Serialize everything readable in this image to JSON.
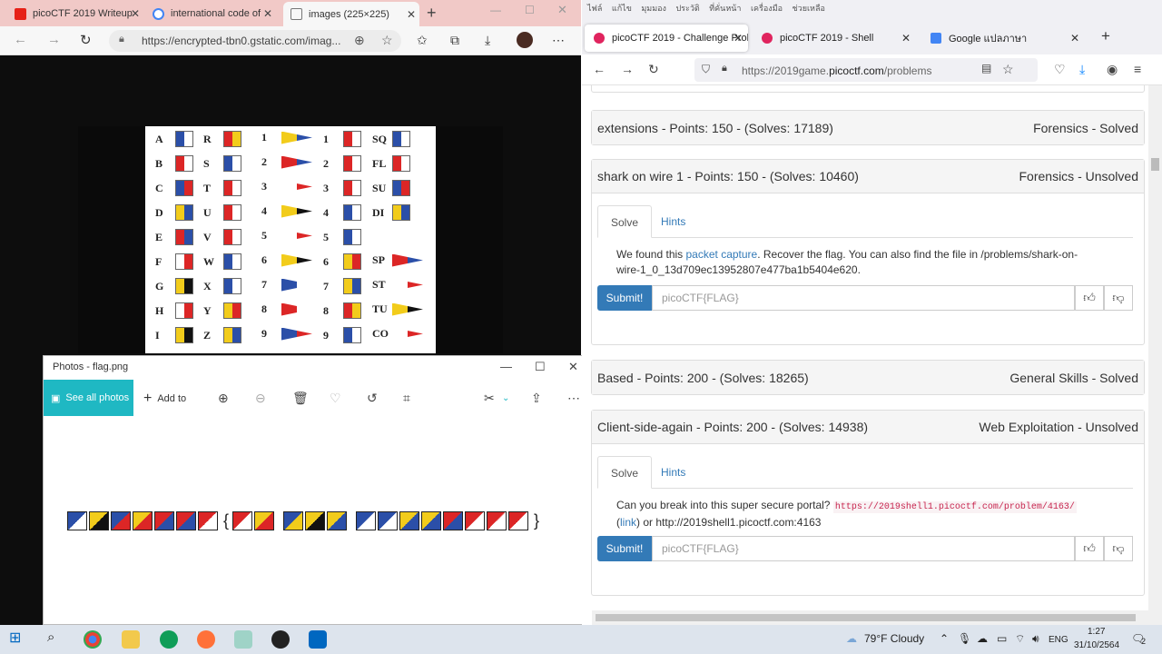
{
  "edge": {
    "tabs": [
      {
        "label": "picoCTF 2019 Writeup",
        "icon": "youtube-icon",
        "color": "#e62117"
      },
      {
        "label": "international code of",
        "icon": "google-icon",
        "color": "#4285f4"
      },
      {
        "label": "images (225×225)",
        "icon": "page-icon",
        "color": "#777"
      }
    ],
    "url": "https://encrypted-tbn0.gstatic.com/imag..."
  },
  "signal_flags": {
    "letters": [
      "A",
      "B",
      "C",
      "D",
      "E",
      "F",
      "G",
      "H",
      "I",
      "R",
      "S",
      "T",
      "U",
      "V",
      "W",
      "X",
      "Y",
      "Z"
    ],
    "numbers": [
      "1",
      "2",
      "3",
      "4",
      "5",
      "6",
      "7",
      "8",
      "9"
    ],
    "subs": [
      "SQ",
      "FL",
      "SU",
      "DI",
      "SP",
      "ST",
      "TU",
      "CO"
    ]
  },
  "photos": {
    "title": "Photos - flag.png",
    "see_all": "See all photos",
    "add_to": "Add to",
    "brace_open": "{",
    "brace_close": "}"
  },
  "firefox": {
    "menu": "ไฟล์ แก้ไข มุมมอง ประวัติ ที่คั่นหน้า เครื่องมือ ช่วยเหลือ",
    "tabs": [
      {
        "label": "picoCTF 2019 - Challenge Probl",
        "color": "#e0245e"
      },
      {
        "label": "picoCTF 2019 - Shell",
        "color": "#e0245e"
      },
      {
        "label": "Google แปลภาษา",
        "color": "#4285f4"
      }
    ],
    "url_prefix": "https://2019game.",
    "url_domain": "picoctf.com",
    "url_suffix": "/problems"
  },
  "problems": [
    {
      "title": "extensions - Points: 150 - (Solves: 17189)",
      "status": "Forensics - Solved"
    },
    {
      "title": "shark on wire 1 - Points: 150 - (Solves: 10460)",
      "status": "Forensics - Unsolved",
      "tab_solve": "Solve",
      "tab_hints": "Hints",
      "desc_pre": "We found this ",
      "desc_link": "packet capture",
      "desc_post": ". Recover the flag. You can also find the file in /problems/shark-on-wire-1_0_13d709ec13952807e477ba1b5404e620.",
      "submit": "Submit!",
      "placeholder": "picoCTF{FLAG}"
    },
    {
      "title": "Based - Points: 200 - (Solves: 18265)",
      "status": "General Skills - Solved"
    },
    {
      "title": "Client-side-again - Points: 200 - (Solves: 14938)",
      "status": "Web Exploitation - Unsolved",
      "tab_solve": "Solve",
      "tab_hints": "Hints",
      "desc_pre": "Can you break into this super secure portal? ",
      "desc_code": "https://2019shell1.picoctf.com/problem/4163/",
      "desc_mid": " (",
      "desc_link": "link",
      "desc_post": ") or http://2019shell1.picoctf.com:4163",
      "submit": "Submit!",
      "placeholder": "picoCTF{FLAG}"
    }
  ],
  "taskbar": {
    "weather": "79°F  Cloudy",
    "lang": "ENG",
    "time": "1:27",
    "date": "31/10/2564",
    "notif": "2"
  }
}
